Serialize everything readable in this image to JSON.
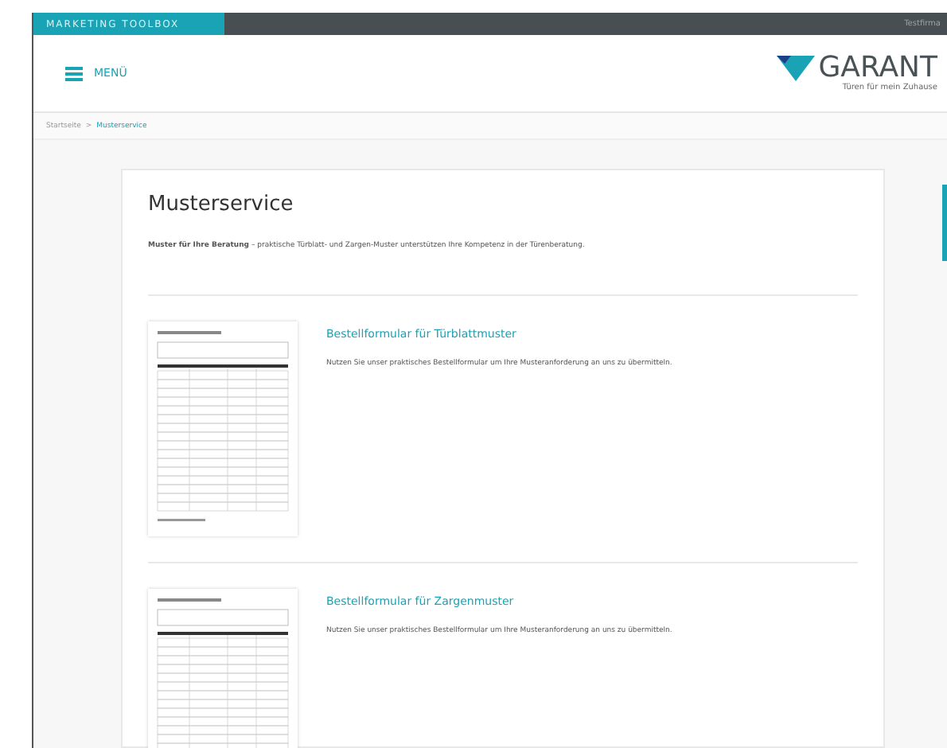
{
  "topbar": {
    "brand": "MARKETING TOOLBOX",
    "account": "Testfirma"
  },
  "header": {
    "menu_label": "MENÜ",
    "logo_text": "GARANT",
    "logo_tagline": "Türen für mein Zuhause"
  },
  "breadcrumb_separator": ">",
  "breadcrumb": [
    {
      "label": "Startseite",
      "selected": false
    },
    {
      "label": "Musterservice",
      "selected": true
    }
  ],
  "page": {
    "title": "Musterservice",
    "intro": "**Muster für Ihre Beratung** – praktische Türblatt- und Zargen-Muster unterstützen Ihre Kompetenz in der Türenberatung.",
    "items": [
      {
        "title": "Bestellformular für Türblattmuster",
        "description": "Nutzen Sie unser praktisches Bestellformular um Ihre Musteranforderung an uns zu übermitteln."
      },
      {
        "title": "Bestellformular für Zargenmuster",
        "description": "Nutzen Sie unser praktisches Bestellformular um Ihre Musteranforderung an uns zu übermitteln."
      }
    ]
  }
}
